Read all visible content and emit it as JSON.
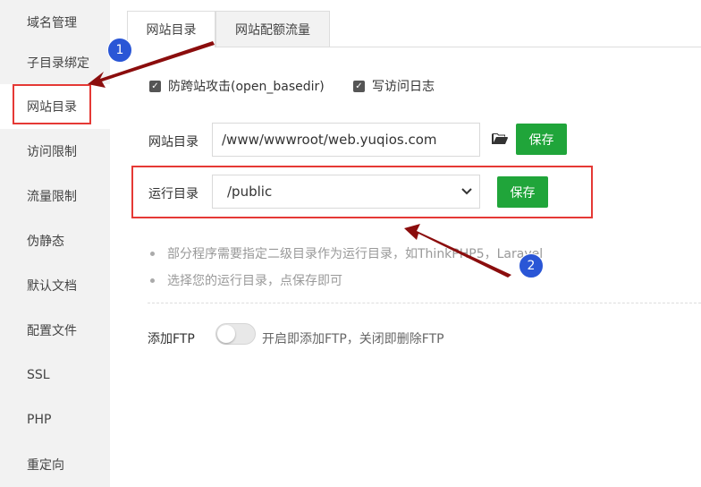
{
  "sidebar": {
    "items": [
      {
        "label": "域名管理"
      },
      {
        "label": "子目录绑定"
      },
      {
        "label": "网站目录"
      },
      {
        "label": "访问限制"
      },
      {
        "label": "流量限制"
      },
      {
        "label": "伪静态"
      },
      {
        "label": "默认文档"
      },
      {
        "label": "配置文件"
      },
      {
        "label": "SSL"
      },
      {
        "label": "PHP"
      },
      {
        "label": "重定向"
      }
    ]
  },
  "tabs": [
    {
      "label": "网站目录"
    },
    {
      "label": "网站配额流量"
    }
  ],
  "options": {
    "open_basedir": "防跨站攻击(open_basedir)",
    "access_log": "写访问日志"
  },
  "site_dir": {
    "label": "网站目录",
    "value": "/www/wwwroot/web.yuqios.com",
    "save_label": "保存"
  },
  "run_dir": {
    "label": "运行目录",
    "value": "/public",
    "save_label": "保存"
  },
  "tips": [
    "部分程序需要指定二级目录作为运行目录，如ThinkPHP5，Laravel",
    "选择您的运行目录，点保存即可"
  ],
  "ftp": {
    "label": "添加FTP",
    "hint": "开启即添加FTP，关闭即删除FTP"
  },
  "annotations": {
    "badge1": "1",
    "badge2": "2"
  },
  "colors": {
    "accent_green": "#20a53a",
    "highlight_red": "#e53935",
    "arrow_darkred": "#8b0d0d",
    "badge_blue": "#2a56d6"
  }
}
